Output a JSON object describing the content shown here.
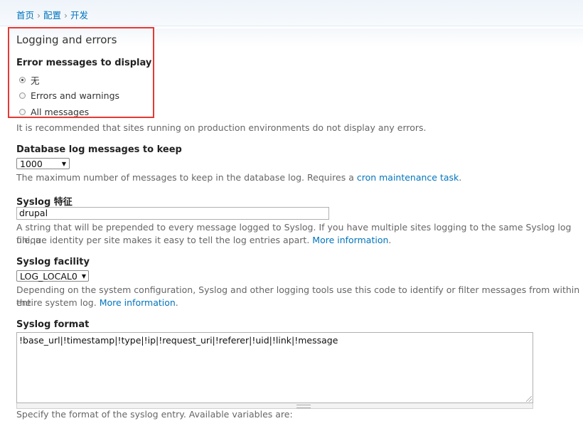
{
  "breadcrumb": {
    "items": [
      "首页",
      "配置",
      "开发"
    ],
    "separator": "›"
  },
  "logging": {
    "fieldset_title": "Logging and errors",
    "error_messages": {
      "label": "Error messages to display",
      "options": [
        "无",
        "Errors and warnings",
        "All messages"
      ],
      "selected_index": 0,
      "description": "It is recommended that sites running on production environments do not display any errors."
    },
    "db_log": {
      "label": "Database log messages to keep",
      "selected": "1000",
      "description_prefix": "The maximum number of messages to keep in the database log. Requires a ",
      "description_link": "cron maintenance task",
      "description_suffix": "."
    },
    "syslog_identity": {
      "label": "Syslog 特征",
      "value": "drupal",
      "description_line1": "A string that will be prepended to every message logged to Syslog. If you have multiple sites logging to the same Syslog log file, a",
      "description_line2_prefix": "unique identity per site makes it easy to tell the log entries apart. ",
      "description_link": "More information",
      "description_suffix": "."
    },
    "syslog_facility": {
      "label": "Syslog facility",
      "selected": "LOG_LOCAL0",
      "description_line1": "Depending on the system configuration, Syslog and other logging tools use this code to identify or filter messages from within the",
      "description_line2_prefix": "entire system log. ",
      "description_link": "More information",
      "description_suffix": "."
    },
    "syslog_format": {
      "label": "Syslog format",
      "value": "!base_url|!timestamp|!type|!ip|!request_uri|!referer|!uid|!link|!message",
      "description": "Specify the format of the syslog entry. Available variables are:"
    }
  },
  "colors": {
    "link": "#0074bd",
    "highlight": "#e53935"
  }
}
